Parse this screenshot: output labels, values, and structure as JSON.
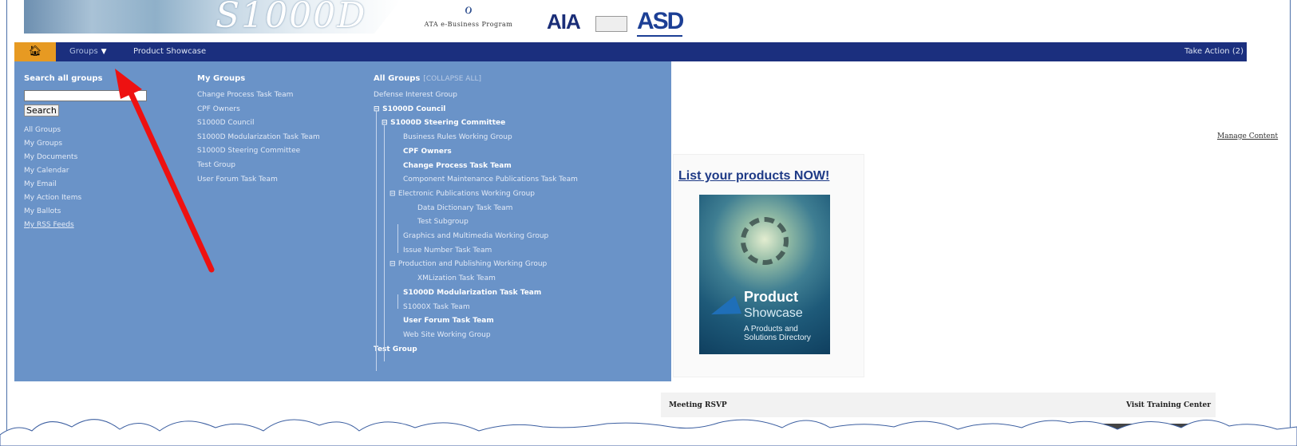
{
  "header": {
    "banner_title": "S1000D",
    "ata_logo_text": "ATA e-Business Program",
    "aia_logo_text": "AIA",
    "asd_logo_text": "ASD"
  },
  "navbar": {
    "home_icon": "home-icon",
    "groups_label": "Groups",
    "product_showcase_label": "Product Showcase",
    "take_action_label": "Take Action (2)",
    "colors": {
      "bar": "#1b2f7e",
      "home": "#e79a22",
      "panel": "#6a93c8"
    }
  },
  "dropdown": {
    "search": {
      "heading": "Search all groups",
      "value": "",
      "button_label": "Search"
    },
    "quick_links": [
      "All Groups",
      "My Groups",
      "My Documents",
      "My Calendar",
      "My Email",
      "My Action Items",
      "My Ballots",
      "My RSS Feeds"
    ],
    "my_groups": {
      "heading": "My Groups",
      "items": [
        "Change Process Task Team",
        "CPF Owners",
        "S1000D Council",
        "S1000D Modularization Task Team",
        "S1000D Steering Committee",
        "Test Group",
        "User Forum Task Team"
      ]
    },
    "all_groups": {
      "heading": "All Groups",
      "collapse_label": "[COLLAPSE ALL]",
      "tree": [
        "Defense Interest Group",
        "S1000D Council",
        "S1000D Steering Committee",
        "Business Rules Working Group",
        "CPF Owners",
        "Change Process Task Team",
        "Component Maintenance Publications Task Team",
        "Electronic Publications Working Group",
        "Data Dictionary Task Team",
        "Test Subgroup",
        "Graphics and Multimedia Working Group",
        "Issue Number Task Team",
        "Production and Publishing Working Group",
        "XMLization Task Team",
        "S1000D Modularization Task Team",
        "S1000X Task Team",
        "User Forum Task Team",
        "Web Site Working Group",
        "Test Group"
      ]
    }
  },
  "content": {
    "manage_content_label": "Manage Content",
    "promo": {
      "title": "List your products NOW!",
      "image_line1": "Product",
      "image_line2": "Showcase",
      "image_line3": "A Products and",
      "image_line4": "Solutions Directory"
    },
    "meeting_rsvp_label": "Meeting RSVP",
    "training_label": "Visit Training Center"
  }
}
